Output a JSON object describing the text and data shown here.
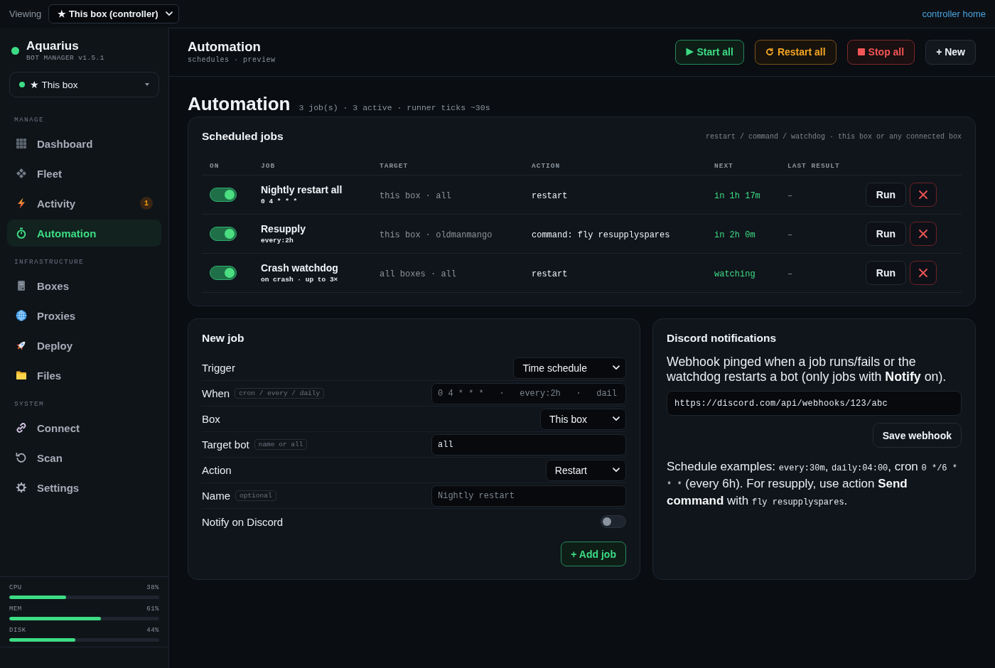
{
  "topbar": {
    "label": "Viewing",
    "viewing": "★ This box (controller)",
    "home_link": "controller home"
  },
  "sidebar": {
    "brand": {
      "name": "Aquarius",
      "subtitle": "BOT MANAGER v1.5.1"
    },
    "box_select": "★ This box",
    "sections": [
      {
        "title": "MANAGE",
        "items": [
          {
            "label": "Dashboard",
            "selected": false
          },
          {
            "label": "Fleet",
            "selected": false
          },
          {
            "label": "Activity",
            "selected": false,
            "badge": "1"
          },
          {
            "label": "Automation",
            "selected": true
          }
        ]
      },
      {
        "title": "INFRASTRUCTURE",
        "items": [
          {
            "label": "Boxes",
            "selected": false
          },
          {
            "label": "Proxies",
            "selected": false
          },
          {
            "label": "Deploy",
            "selected": false
          },
          {
            "label": "Files",
            "selected": false
          }
        ]
      },
      {
        "title": "SYSTEM",
        "items": [
          {
            "label": "Connect",
            "selected": false
          },
          {
            "label": "Scan",
            "selected": false
          },
          {
            "label": "Settings",
            "selected": false
          }
        ]
      }
    ],
    "meters": [
      {
        "label": "CPU",
        "reading": "38%",
        "level": 0.38
      },
      {
        "label": "MEM",
        "reading": "61%",
        "level": 0.61
      },
      {
        "label": "DISK",
        "reading": "44%",
        "level": 0.44
      }
    ]
  },
  "header": {
    "title": "Automation",
    "subtitle": "schedules · preview",
    "buttons": [
      {
        "kind": "start",
        "label": "Start all"
      },
      {
        "kind": "restart",
        "label": "Restart all"
      },
      {
        "kind": "stop",
        "label": "Stop all"
      },
      {
        "kind": "new",
        "label": "+ New"
      }
    ]
  },
  "page": {
    "title": "Automation",
    "summary": "3 job(s) · 3 active · runner ticks ~30s"
  },
  "jobs": {
    "title": "Scheduled jobs",
    "hint": "restart / command / watchdog · this box or any connected box",
    "columns": [
      "ON",
      "JOB",
      "TARGET",
      "ACTION",
      "NEXT",
      "LAST RESULT"
    ],
    "rows": [
      {
        "on": true,
        "name": "Nightly restart all",
        "schedule": "0 4 * * *",
        "target": "this box · all",
        "action": "restart",
        "next": "in 1h 17m",
        "last_result": "–",
        "run": "Run"
      },
      {
        "on": true,
        "name": "Resupply",
        "schedule": "every:2h",
        "target": "this box · oldmanmango",
        "action": "command: fly resupplyspares",
        "next": "in 2h 0m",
        "last_result": "–",
        "run": "Run"
      },
      {
        "on": true,
        "name": "Crash watchdog",
        "schedule": "on crash · up to 3×",
        "target": "all boxes · all",
        "action": "restart",
        "next": "watching",
        "last_result": "–",
        "run": "Run"
      }
    ]
  },
  "new_job": {
    "title": "New job",
    "fields": [
      {
        "kind": "select",
        "label": "Trigger",
        "value": "Time schedule"
      },
      {
        "kind": "input",
        "label": "When",
        "hint": "cron / every / daily",
        "placeholder": "0 4 * * *   ·   every:2h   ·   dail"
      },
      {
        "kind": "select",
        "label": "Box",
        "value": "This box"
      },
      {
        "kind": "input",
        "label": "Target bot",
        "hint": "name or all",
        "value": "all"
      },
      {
        "kind": "select",
        "label": "Action",
        "value": "Restart"
      },
      {
        "kind": "input",
        "label": "Name",
        "hint": "optional",
        "placeholder": "Nightly restart"
      },
      {
        "kind": "toggle",
        "label": "Notify on Discord",
        "on": false
      }
    ],
    "submit": "+ Add job"
  },
  "discord": {
    "title": "Discord notifications",
    "description": "Webhook pinged when a job runs/fails or the watchdog restarts a bot (only jobs with **Notify** on).",
    "webhook": "https://discord.com/api/webhooks/123/abc",
    "save": "Save webhook",
    "examples": [
      {
        "kind": "text",
        "text": "Schedule examples: "
      },
      {
        "kind": "code",
        "text": "every:30m"
      },
      {
        "kind": "text",
        "text": ", "
      },
      {
        "kind": "code",
        "text": "daily:04:00"
      },
      {
        "kind": "text",
        "text": ", cron "
      },
      {
        "kind": "code",
        "text": "0 */6 * * *"
      },
      {
        "kind": "text",
        "text": " (every 6h). For resupply, use action **Send command** with "
      },
      {
        "kind": "code",
        "text": "fly resupplyspares"
      },
      {
        "kind": "text",
        "text": "."
      }
    ]
  }
}
